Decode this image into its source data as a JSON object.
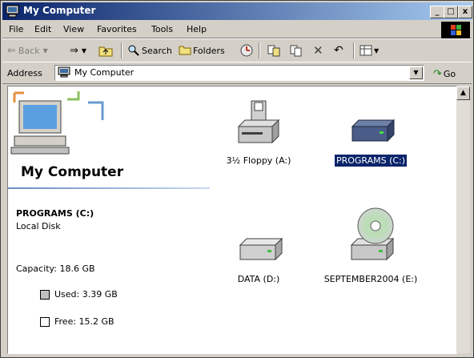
{
  "window": {
    "title": "My Computer"
  },
  "menu": [
    "File",
    "Edit",
    "View",
    "Favorites",
    "Tools",
    "Help"
  ],
  "toolbar": {
    "back_label": "Back",
    "search_label": "Search",
    "folders_label": "Folders"
  },
  "address": {
    "label": "Address",
    "value": "My Computer",
    "go_label": "Go"
  },
  "left_pane": {
    "heading": "My Computer",
    "selected_drive": "PROGRAMS (C:)",
    "drive_type": "Local Disk",
    "capacity": "Capacity: 18.6 GB",
    "used": "Used: 3.39 GB",
    "free": "Free: 15.2 GB",
    "used_color": "#c0c0c0",
    "free_color": "#ffffff"
  },
  "drives": [
    {
      "label": "3½ Floppy (A:)",
      "icon": "floppy-drive-icon",
      "selected": false
    },
    {
      "label": "PROGRAMS (C:)",
      "icon": "hard-drive-icon",
      "selected": true
    },
    {
      "label": "DATA (D:)",
      "icon": "hard-drive-icon",
      "selected": false
    },
    {
      "label": "SEPTEMBER2004 (E:)",
      "icon": "cd-drive-icon",
      "selected": false
    }
  ],
  "colors": {
    "titlebar_start": "#0a246a",
    "titlebar_end": "#a6caf0",
    "selection": "#0a246a"
  }
}
